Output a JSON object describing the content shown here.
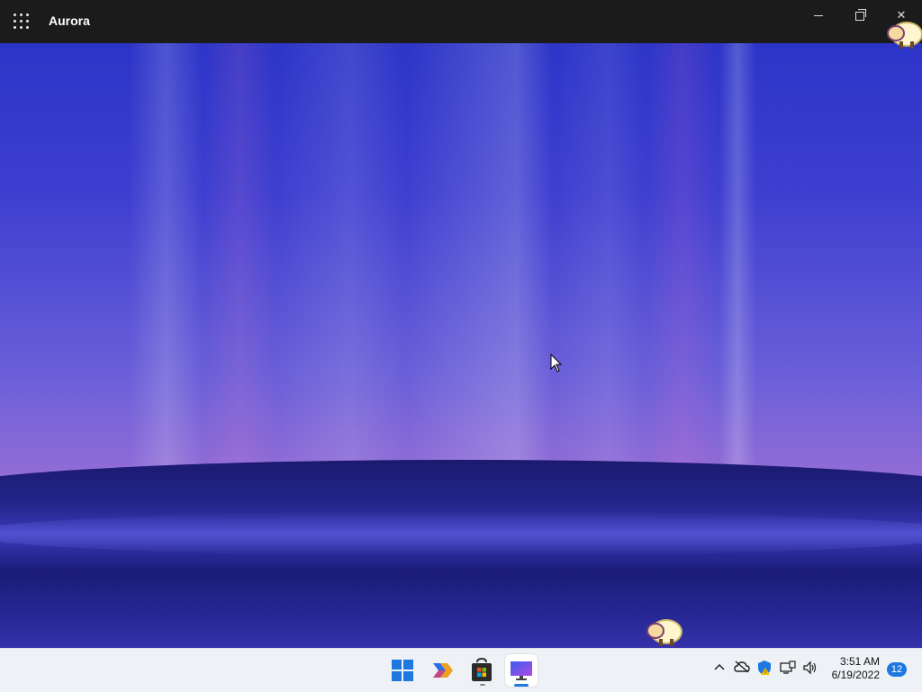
{
  "window": {
    "title": "Aurora"
  },
  "taskbar": {
    "apps": [
      {
        "name": "Start"
      },
      {
        "name": "Copilot"
      },
      {
        "name": "Microsoft Store"
      },
      {
        "name": "Aurora"
      }
    ],
    "clock": {
      "time": "3:51 AM",
      "date": "6/19/2022"
    },
    "notification_count": "12"
  },
  "colors": {
    "accent": "#1e78e0",
    "titlebar": "#1b1b1b",
    "taskbar": "#eef1f5"
  }
}
